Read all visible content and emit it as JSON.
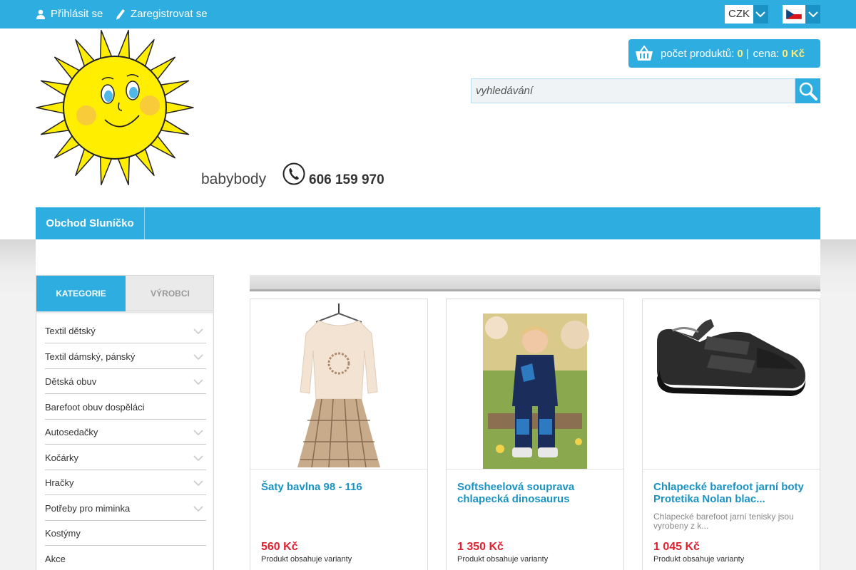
{
  "topbar": {
    "login_label": "Přihlásit se",
    "register_label": "Zaregistrovat se",
    "currency": "CZK",
    "language_flag": "czech-flag-icon"
  },
  "header": {
    "tagline": "babybody",
    "phone": "606 159 970",
    "logo": "sun-logo"
  },
  "cart": {
    "count_label": "počet produktů:",
    "count": "0",
    "separator": "|",
    "price_label": "cena:",
    "price": "0 Kč"
  },
  "search": {
    "placeholder": "vyhledávání"
  },
  "nav": {
    "items": [
      "Obchod Sluníčko"
    ]
  },
  "sidebar": {
    "tabs": [
      "KATEGORIE",
      "VÝROBCI"
    ],
    "active_tab": "KATEGORIE",
    "categories": [
      {
        "label": "Textil dětský",
        "has_children": true
      },
      {
        "label": "Textil dámský, pánský",
        "has_children": true
      },
      {
        "label": "Dětská obuv",
        "has_children": true
      },
      {
        "label": "Barefoot obuv dospěláci",
        "has_children": false
      },
      {
        "label": "Autosedačky",
        "has_children": true
      },
      {
        "label": "Kočárky",
        "has_children": true
      },
      {
        "label": "Hračky",
        "has_children": true
      },
      {
        "label": "Potřeby pro miminka",
        "has_children": true
      },
      {
        "label": "Kostýmy",
        "has_children": false
      },
      {
        "label": "Akce",
        "has_children": false
      }
    ]
  },
  "products": [
    {
      "title": "Šaty bavlna 98 - 116",
      "description": "",
      "price": "560 Kč",
      "variants": "Produkt obsahuje varianty",
      "image": "dress-image"
    },
    {
      "title": "Softsheelová souprava chlapecká dinosaurus",
      "description": "",
      "price": "1 350 Kč",
      "variants": "Produkt obsahuje varianty",
      "image": "boy-softshell-image"
    },
    {
      "title": "Chlapecké barefoot jarní boty Protetika Nolan blac...",
      "description": "Chlapecké barefoot jarní tenisky jsou vyrobeny z k...",
      "price": "1 045 Kč",
      "variants": "Produkt obsahuje varianty",
      "image": "shoe-image"
    }
  ],
  "colors": {
    "accent": "#2eaee0",
    "price": "#e0202f",
    "sun": "#ffee00"
  }
}
